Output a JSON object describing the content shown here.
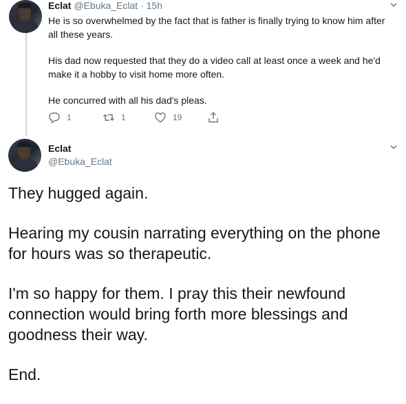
{
  "tweet1": {
    "name": "Eclat",
    "handle": "@Ebuka_Eclat",
    "separator": "·",
    "time": "15h",
    "paragraphs": [
      "He is so overwhelmed by the fact that is father is finally trying to know him after all these years.",
      "His dad now requested that they do a video call at least once a week and he'd make it a hobby to visit home more often.",
      "He concurred with all his dad's pleas."
    ],
    "replies": "1",
    "retweets": "1",
    "likes": "19",
    "icons": [
      "reply-icon",
      "retweet-icon",
      "like-icon",
      "share-icon",
      "chevron-down-icon"
    ]
  },
  "tweet2": {
    "name": "Eclat",
    "handle": "@Ebuka_Eclat",
    "paragraphs": [
      "They hugged again.",
      "Hearing my cousin narrating everything on the phone for hours was so therapeutic.",
      "I'm so happy for them. I pray this their newfound connection would bring forth more blessings and goodness their way.",
      "End."
    ]
  },
  "colors": {
    "text": "#14171a",
    "muted": "#657786",
    "thread_line": "#cbd5dc",
    "background": "#ffffff"
  }
}
